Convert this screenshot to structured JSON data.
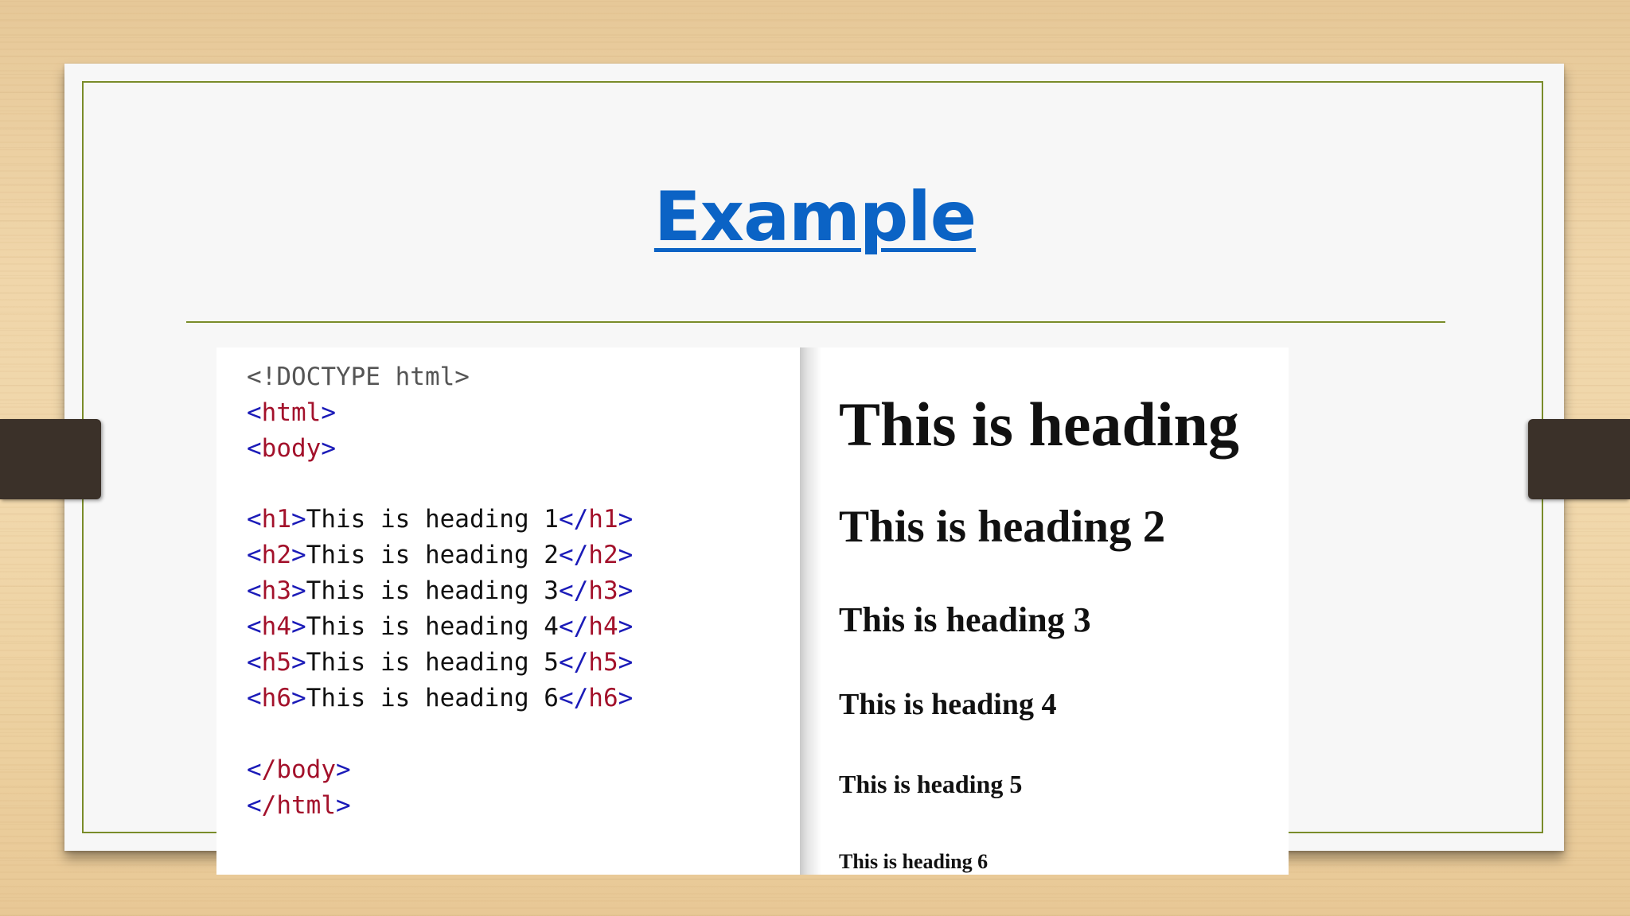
{
  "slide": {
    "title": "Example"
  },
  "code": {
    "doctype": "<!DOCTYPE html>",
    "html_open": "html",
    "body_open": "body",
    "lines": [
      {
        "tag": "h1",
        "text": "This is heading 1"
      },
      {
        "tag": "h2",
        "text": "This is heading 2"
      },
      {
        "tag": "h3",
        "text": "This is heading 3"
      },
      {
        "tag": "h4",
        "text": "This is heading 4"
      },
      {
        "tag": "h5",
        "text": "This is heading 5"
      },
      {
        "tag": "h6",
        "text": "This is heading 6"
      }
    ],
    "body_close": "/body",
    "html_close": "/html"
  },
  "rendered": {
    "h1": "This is heading",
    "h2": "This is heading 2",
    "h3": "This is heading 3",
    "h4": "This is heading 4",
    "h5": "This is heading 5",
    "h6": "This is heading 6"
  },
  "colors": {
    "title": "#0b63c5",
    "border": "#7a8c2a",
    "tag_name": "#a3112b",
    "tag_bracket": "#1b1bb8",
    "binder_clip": "#3b3129"
  }
}
